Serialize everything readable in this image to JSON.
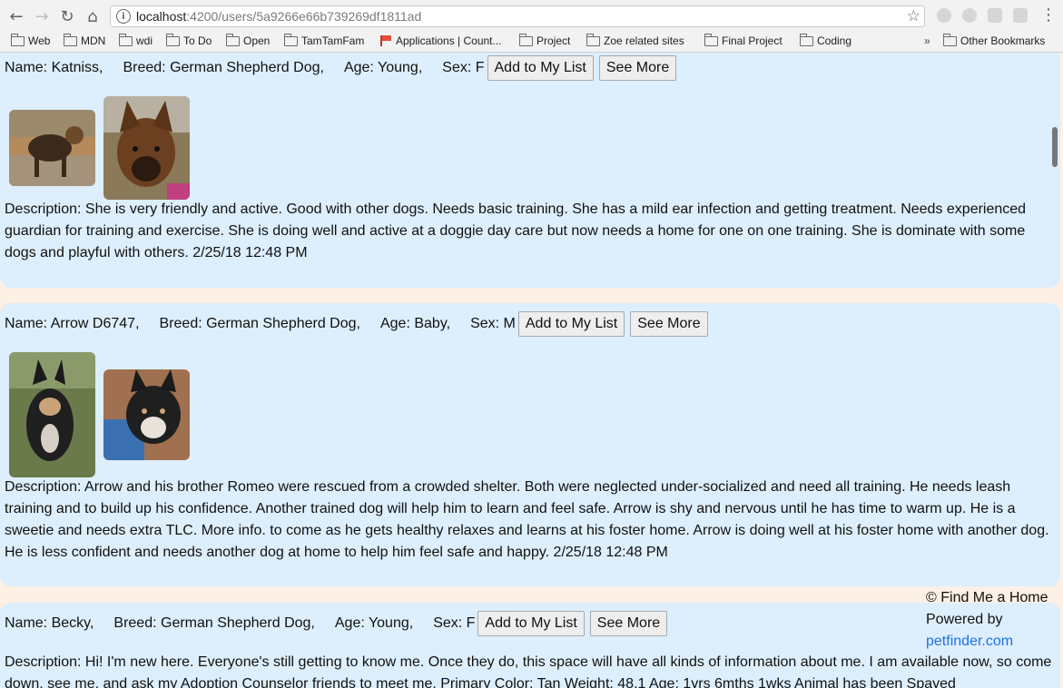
{
  "browser": {
    "url_host": "localhost",
    "url_path": ":4200/users/5a9266e66b739269df1811ad",
    "bookmarks": [
      "Web",
      "MDN",
      "wdi",
      "To Do",
      "Open",
      "TamTamFam",
      "Applications | Count...",
      "Project",
      "Zoe related sites",
      "Final Project",
      "Coding"
    ],
    "other_bookmarks": "Other Bookmarks",
    "overflow": "»"
  },
  "pets": [
    {
      "name": "Name: Katniss,",
      "breed": "Breed: German Shepherd Dog,",
      "age": "Age: Young,",
      "sex": "Sex: F",
      "add_label": "Add to My List",
      "more_label": "See More",
      "description": "Description: She is very friendly and active. Good with other dogs. Needs basic training. She has a mild ear infection and getting treatment. Needs experienced guardian for training and exercise. She is doing well and active at a doggie day care but now needs a home for one on one training. She is dominate with some dogs and playful with others. 2/25/18 12:48 PM"
    },
    {
      "name": "Name: Arrow D6747,",
      "breed": "Breed: German Shepherd Dog,",
      "age": "Age: Baby,",
      "sex": "Sex: M",
      "add_label": "Add to My List",
      "more_label": "See More",
      "description": "Description: Arrow and his brother Romeo were rescued from a crowded shelter. Both were neglected under-socialized and need all training. He needs leash training and to build up his confidence. Another trained dog will help him to learn and feel safe. Arrow is shy and nervous until he has time to warm up. He is a sweetie and needs extra TLC. More info. to come as he gets healthy relaxes and learns at his foster home. Arrow is doing well at his foster home with another dog. He is less confident and needs another dog at home to help him feel safe and happy. 2/25/18 12:48 PM"
    },
    {
      "name": "Name: Becky,",
      "breed": "Breed: German Shepherd Dog,",
      "age": "Age: Young,",
      "sex": "Sex: F",
      "add_label": "Add to My List",
      "more_label": "See More",
      "description": "Description: Hi! I'm new here. Everyone's still getting to know me. Once they do, this space will have all kinds of information about me. I am available now, so come down, see me, and ask my Adoption Counselor friends to meet me. Primary Color: Tan Weight: 48.1 Age: 1yrs 6mths 1wks Animal has been Spayed"
    }
  ],
  "footer": {
    "copyright": "© Find Me a Home",
    "powered": "Powered by",
    "link": "petfinder.com"
  }
}
